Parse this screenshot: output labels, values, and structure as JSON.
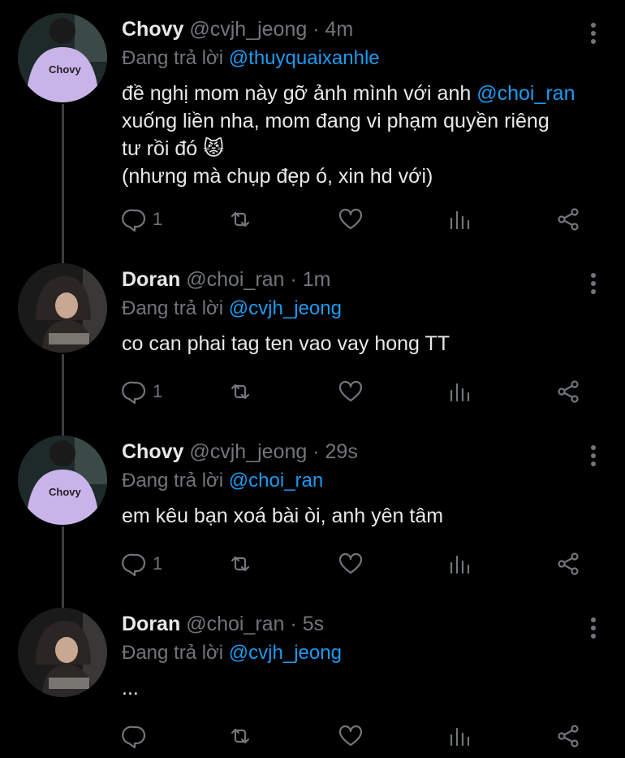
{
  "tweets": [
    {
      "name": "Chovy",
      "handle": "@cvjh_jeong",
      "time": "· 4m",
      "replying_prefix": "Đang trả lời",
      "replying_to": "@thuyquaixanhle",
      "text_line1_a": "đề nghị mom này gỡ ảnh mình với anh ",
      "text_line1_mention": "@choi_ran",
      "text_line2": "xuống liền nha, mom đang vi phạm quyền riêng",
      "text_line3": "tư rồi đó 😾",
      "text_line4": "(nhưng mà chụp đẹp ó, xin hd với)",
      "reply_count": "1",
      "avatar": "chovy-avatar"
    },
    {
      "name": "Doran",
      "handle": "@choi_ran",
      "time": "· 1m",
      "replying_prefix": "Đang trả lời",
      "replying_to": "@cvjh_jeong",
      "text": "co can phai tag ten vao vay hong TT",
      "reply_count": "1",
      "avatar": "doran-avatar"
    },
    {
      "name": "Chovy",
      "handle": "@cvjh_jeong",
      "time": "· 29s",
      "replying_prefix": "Đang trả lời",
      "replying_to": "@choi_ran",
      "text": "em kêu bạn xoá bài òi, anh yên tâm",
      "reply_count": "1",
      "avatar": "chovy-avatar"
    },
    {
      "name": "Doran",
      "handle": "@choi_ran",
      "time": "· 5s",
      "replying_prefix": "Đang trả lời",
      "replying_to": "@cvjh_jeong",
      "text": "...",
      "reply_count": "",
      "avatar": "doran-avatar"
    }
  ],
  "avatar_text": "Chovy",
  "colors": {
    "background": "#000000",
    "text": "#e7e9ea",
    "muted": "#71767b",
    "link": "#1d9bf0",
    "chovy_avatar": "#c8b2e8",
    "doran_avatar": "#2a2522"
  },
  "icons": [
    "reply-icon",
    "retweet-icon",
    "like-icon",
    "analytics-icon",
    "share-icon",
    "more-icon"
  ]
}
